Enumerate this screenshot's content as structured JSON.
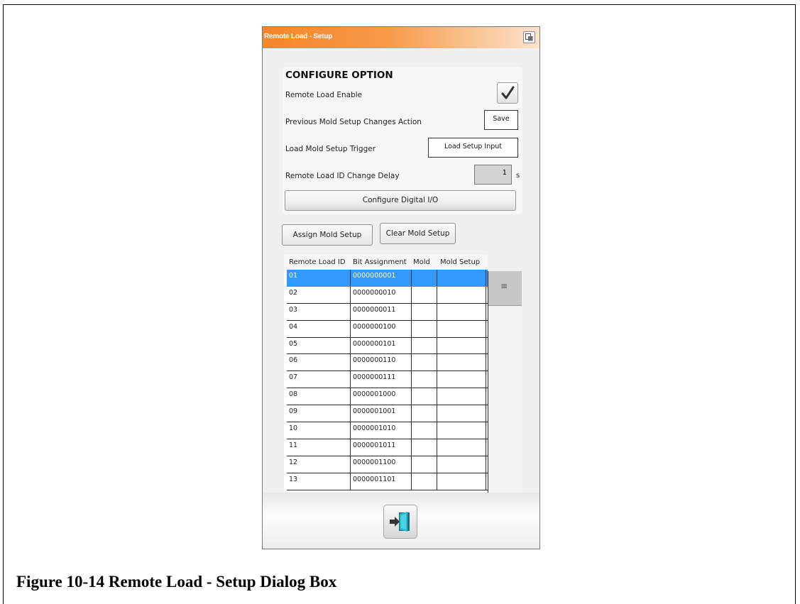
{
  "dialog": {
    "title": "Remote Load - Setup",
    "restore_icon": "window-restore-icon"
  },
  "configure": {
    "section_title": "CONFIGURE OPTION",
    "remote_load_enable_label": "Remote Load Enable",
    "remote_load_enable_checked": true,
    "prev_changes_label": "Previous Mold Setup Changes Action",
    "prev_changes_value": "Save",
    "trigger_label": "Load Mold Setup Trigger",
    "trigger_value": "Load Setup Input",
    "delay_label": "Remote Load ID Change Delay",
    "delay_value": "1",
    "delay_unit": "s",
    "digital_io_button": "Configure Digital I/O"
  },
  "actions": {
    "assign_button": "Assign Mold Setup",
    "clear_button": "Clear Mold Setup"
  },
  "table": {
    "headers": [
      "Remote Load ID",
      "Bit Assignment",
      "Mold",
      "Mold Setup"
    ],
    "selected_index": 0,
    "rows": [
      {
        "id": "01",
        "bits": "0000000001",
        "mold": "",
        "setup": ""
      },
      {
        "id": "02",
        "bits": "0000000010",
        "mold": "",
        "setup": ""
      },
      {
        "id": "03",
        "bits": "0000000011",
        "mold": "",
        "setup": ""
      },
      {
        "id": "04",
        "bits": "0000000100",
        "mold": "",
        "setup": ""
      },
      {
        "id": "05",
        "bits": "0000000101",
        "mold": "",
        "setup": ""
      },
      {
        "id": "06",
        "bits": "0000000110",
        "mold": "",
        "setup": ""
      },
      {
        "id": "07",
        "bits": "0000000111",
        "mold": "",
        "setup": ""
      },
      {
        "id": "08",
        "bits": "0000001000",
        "mold": "",
        "setup": ""
      },
      {
        "id": "09",
        "bits": "0000001001",
        "mold": "",
        "setup": ""
      },
      {
        "id": "10",
        "bits": "0000001010",
        "mold": "",
        "setup": ""
      },
      {
        "id": "11",
        "bits": "0000001011",
        "mold": "",
        "setup": ""
      },
      {
        "id": "12",
        "bits": "0000001100",
        "mold": "",
        "setup": ""
      },
      {
        "id": "13",
        "bits": "0000001101",
        "mold": "",
        "setup": ""
      }
    ],
    "scroll_grip": "≡"
  },
  "footer": {
    "exit_icon": "exit-door-icon"
  },
  "caption": "Figure 10-14  Remote Load - Setup Dialog Box",
  "colors": {
    "title_gradient_start": "#f4862a",
    "selected_row": "#3399ff"
  }
}
